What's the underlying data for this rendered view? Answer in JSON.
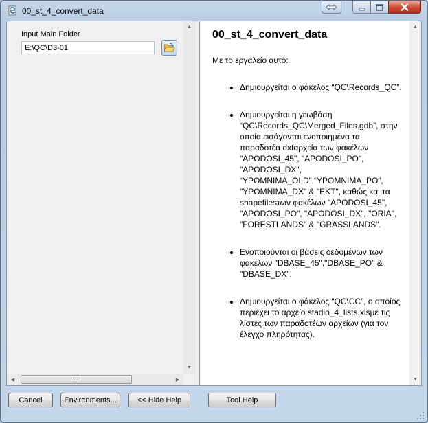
{
  "window": {
    "title": "00_st_4_convert_data",
    "icon": "python-script-icon"
  },
  "titlebar_buttons": [
    "restore-icon",
    "minimize-icon",
    "maximize-icon",
    "close-icon"
  ],
  "left_pane": {
    "param_label": "Input Main Folder",
    "folder_value": "E:\\QC\\D3-01",
    "browse_icon": "open-folder-icon",
    "hscroll_grip": "III"
  },
  "help": {
    "title": "00_st_4_convert_data",
    "intro": "Με το εργαλείο αυτό:",
    "items": [
      "Δημιουργείται ο φάκελος “QC\\Records_QC”.",
      "Δημιουργείται η γεωβάση “QC\\Records_QC\\Merged_Files.gdb”, στην οποία εισάγονται ενοποιημένα τα παραδοτέα dxfαρχεία των φακέλων \"APODOSI_45\", \"APODOSI_PO\", \"APODOSI_DX\", “YPOMNIMA_OLD”,“YPOMNIMA_PO”, \"YPOMNIMA_DX\" & \"EKT\", καθώς και τα shapefilesτων φακέλων \"APODOSI_45\", \"APODOSI_PO\", \"APODOSI_DX\", \"ORIA\", \"FORESTLANDS\" & \"GRASSLANDS\".",
      "Ενοποιούνται οι βάσεις δεδομένων των φακέλων \"DBASE_45\",\"DBASE_PO\" & \"DBASE_DX\".",
      "Δημιουργείται ο φάκελος “QC\\CC”, ο οποίος περιέχει το αρχείο stadio_4_lists.xlsμε τις λίστες των παραδοτέων αρχείων (για τον έλεγχο πληρότητας)."
    ]
  },
  "buttons": {
    "cancel": "Cancel",
    "environments": "Environments...",
    "hide_help": "<< Hide Help",
    "tool_help": "Tool Help"
  }
}
